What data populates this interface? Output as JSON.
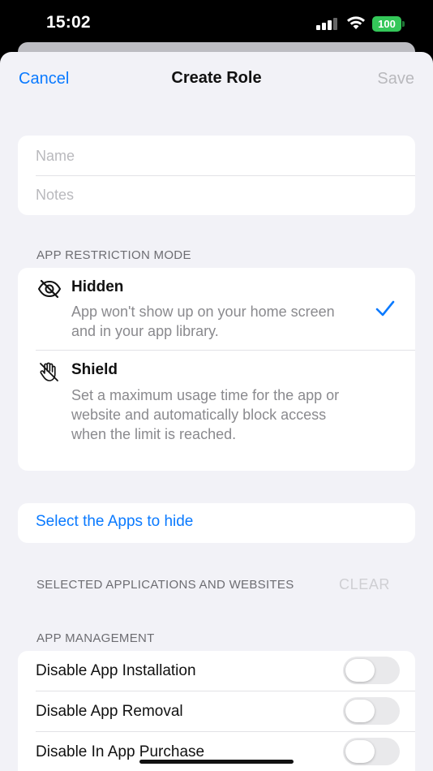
{
  "status_bar": {
    "time": "15:02",
    "battery_level": "100",
    "icons": [
      "signal-icon",
      "wifi-icon",
      "battery-icon"
    ]
  },
  "nav": {
    "cancel_label": "Cancel",
    "title": "Create Role",
    "save_label": "Save"
  },
  "form": {
    "name_placeholder": "Name",
    "notes_placeholder": "Notes"
  },
  "restriction": {
    "header": "APP RESTRICTION MODE",
    "options": [
      {
        "icon": "eye-slash-icon",
        "title": "Hidden",
        "description": "App won't show up on your home screen and in your app library.",
        "selected": true
      },
      {
        "icon": "hand-raised-slash-icon",
        "title": "Shield",
        "description": "Set a maximum usage time for the app or website and automatically block access when the limit is reached.",
        "selected": false
      }
    ]
  },
  "select_apps": {
    "label": "Select the Apps to hide"
  },
  "selected_apps": {
    "header": "SELECTED APPLICATIONS AND WEBSITES",
    "clear_label": "CLEAR"
  },
  "management": {
    "header": "APP MANAGEMENT",
    "items": [
      {
        "label": "Disable App Installation",
        "on": false
      },
      {
        "label": "Disable App Removal",
        "on": false
      },
      {
        "label": "Disable In App Purchase",
        "on": false
      }
    ]
  },
  "colors": {
    "accent": "#0a7aff",
    "battery": "#34c759",
    "background": "#f2f2f7"
  }
}
